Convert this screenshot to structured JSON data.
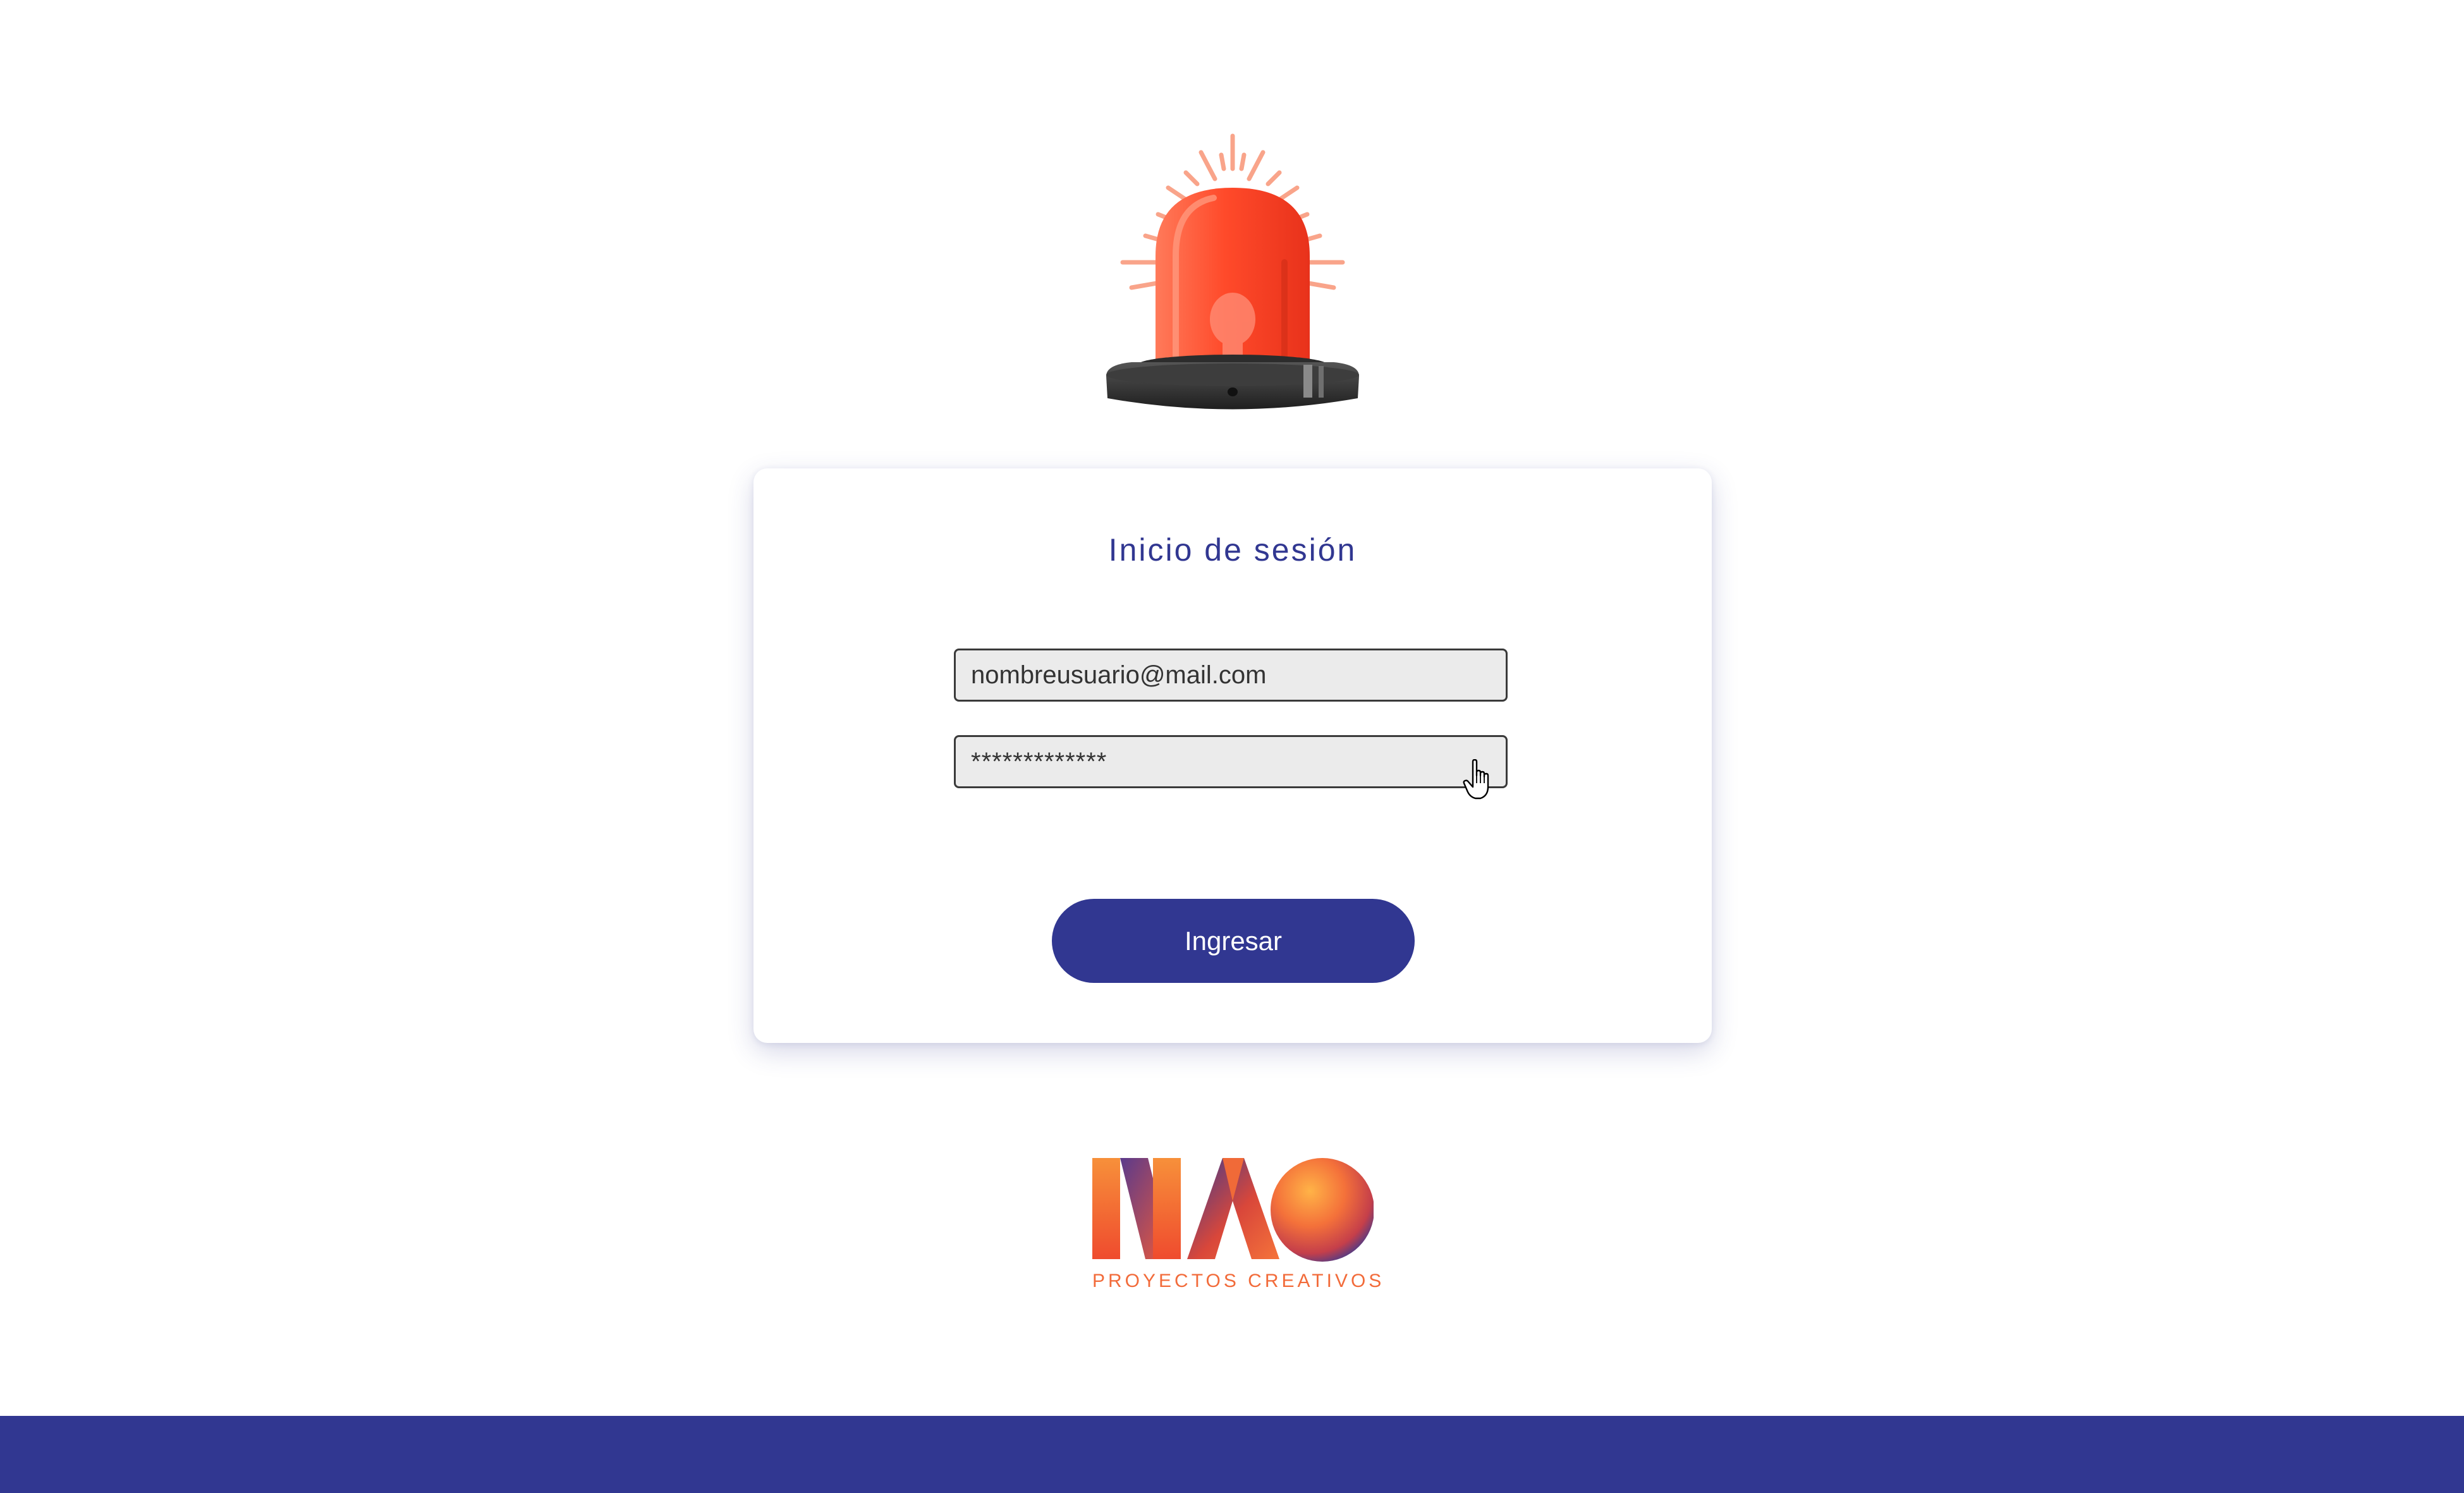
{
  "login": {
    "title": "Inicio de sesión",
    "email_value": "nombreusuario@mail.com",
    "password_value": "*************",
    "submit_label": "Ingresar"
  },
  "brand": {
    "wordmark": "NAO",
    "tagline": "PROYECTOS CREATIVOS"
  },
  "icons": {
    "siren": "siren-alarm-icon",
    "cursor": "hand-pointer-cursor-icon"
  },
  "colors": {
    "primary": "#313791",
    "siren_red": "#ff4b2b",
    "brand_orange": "#f26b3a",
    "field_background": "#ebebeb"
  }
}
